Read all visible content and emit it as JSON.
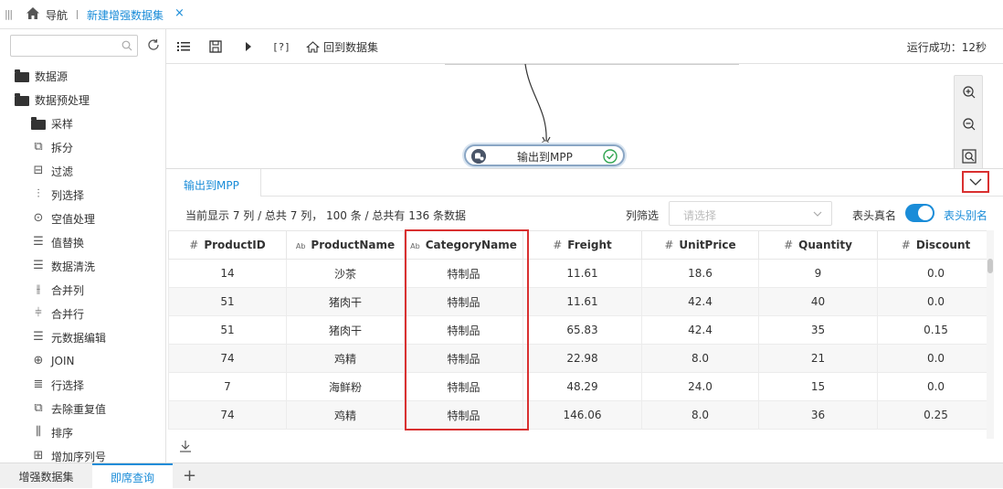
{
  "topbar": {
    "nav_label": "导航",
    "tab_label": "新建增强数据集",
    "tab_close": "×"
  },
  "sidebar": {
    "search": {
      "placeholder": "",
      "value": ""
    },
    "items": [
      {
        "label": "数据源",
        "icon": "folder-icon",
        "level": 0
      },
      {
        "label": "数据预处理",
        "icon": "folder-open-icon",
        "level": 0
      },
      {
        "label": "采样",
        "icon": "folder-icon",
        "level": 1
      },
      {
        "label": "拆分",
        "icon": "split-icon",
        "level": 1
      },
      {
        "label": "过滤",
        "icon": "filter-icon",
        "level": 1
      },
      {
        "label": "列选择",
        "icon": "column-select-icon",
        "level": 1
      },
      {
        "label": "空值处理",
        "icon": "null-handle-icon",
        "level": 1
      },
      {
        "label": "值替换",
        "icon": "value-replace-icon",
        "level": 1
      },
      {
        "label": "数据清洗",
        "icon": "data-clean-icon",
        "level": 1
      },
      {
        "label": "合并列",
        "icon": "merge-column-icon",
        "level": 1
      },
      {
        "label": "合并行",
        "icon": "merge-row-icon",
        "level": 1
      },
      {
        "label": "元数据编辑",
        "icon": "metadata-edit-icon",
        "level": 1
      },
      {
        "label": "JOIN",
        "icon": "join-icon",
        "level": 1
      },
      {
        "label": "行选择",
        "icon": "row-select-icon",
        "level": 1
      },
      {
        "label": "去除重复值",
        "icon": "dedupe-icon",
        "level": 1
      },
      {
        "label": "排序",
        "icon": "sort-icon",
        "level": 1
      },
      {
        "label": "增加序列号",
        "icon": "add-serial-icon",
        "level": 1
      }
    ]
  },
  "toolbar": {
    "help_label": "[?]",
    "back_label": "回到数据集",
    "status": "运行成功：12秒"
  },
  "canvas": {
    "node_label": "输出到MPP"
  },
  "panel": {
    "tab_label": "输出到MPP",
    "summary": "当前显示 7 列 / 总共 7 列， 100 条 / 总共有 136 条数据",
    "col_filter_label": "列筛选",
    "col_filter_placeholder": "请选择",
    "header_real_label": "表头真名",
    "header_alias_label": "表头别名",
    "toggle_on": true
  },
  "table": {
    "columns": [
      {
        "name": "ProductID",
        "type": "#"
      },
      {
        "name": "ProductName",
        "type": "Ab"
      },
      {
        "name": "CategoryName",
        "type": "Ab"
      },
      {
        "name": "Freight",
        "type": "#"
      },
      {
        "name": "UnitPrice",
        "type": "#"
      },
      {
        "name": "Quantity",
        "type": "#"
      },
      {
        "name": "Discount",
        "type": "#"
      }
    ],
    "rows": [
      [
        "14",
        "沙茶",
        "特制品",
        "11.61",
        "18.6",
        "9",
        "0.0"
      ],
      [
        "51",
        "猪肉干",
        "特制品",
        "11.61",
        "42.4",
        "40",
        "0.0"
      ],
      [
        "51",
        "猪肉干",
        "特制品",
        "65.83",
        "42.4",
        "35",
        "0.15"
      ],
      [
        "74",
        "鸡精",
        "特制品",
        "22.98",
        "8.0",
        "21",
        "0.0"
      ],
      [
        "7",
        "海鲜粉",
        "特制品",
        "48.29",
        "24.0",
        "15",
        "0.0"
      ],
      [
        "74",
        "鸡精",
        "特制品",
        "146.06",
        "8.0",
        "36",
        "0.25"
      ]
    ]
  },
  "bottom_tabs": [
    {
      "label": "增强数据集",
      "active": false
    },
    {
      "label": "即席查询",
      "active": true
    }
  ],
  "add_tab_label": "+",
  "colors": {
    "accent": "#1a8cd8",
    "highlight": "#d93030"
  }
}
